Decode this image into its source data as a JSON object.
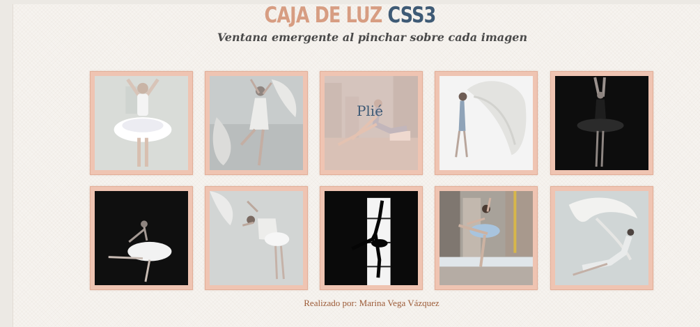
{
  "header": {
    "title_part1": "CAJA DE LUZ",
    "title_part2": "CSS3",
    "subtitle": "Ventana emergente al pinchar sobre cada imagen"
  },
  "gallery": {
    "hover_label": "Plié",
    "images": [
      {
        "name": "photo-ballerina-white-tutu",
        "style": "light"
      },
      {
        "name": "photo-dancer-flowing-fabric",
        "style": "grey"
      },
      {
        "name": "photo-dancer-city-jump",
        "style": "city"
      },
      {
        "name": "photo-dancer-silk-scarf",
        "style": "white"
      },
      {
        "name": "photo-ballerina-black-tutu",
        "style": "dark"
      },
      {
        "name": "photo-ballerina-arabesque-dark",
        "style": "dark"
      },
      {
        "name": "photo-dancer-arched-back",
        "style": "grey"
      },
      {
        "name": "photo-dancer-window-silhouette",
        "style": "silhouette"
      },
      {
        "name": "photo-ballerina-rooftop",
        "style": "city"
      },
      {
        "name": "photo-dancer-floating-silk",
        "style": "white"
      }
    ]
  },
  "footer": {
    "credit": "Realizado por: Marina Vega Vázquez"
  },
  "colors": {
    "title_accent": "#d79d82",
    "title_dark": "#3e5a75",
    "tile_border": "#efc4b2",
    "footer_text": "#9b5a36"
  }
}
